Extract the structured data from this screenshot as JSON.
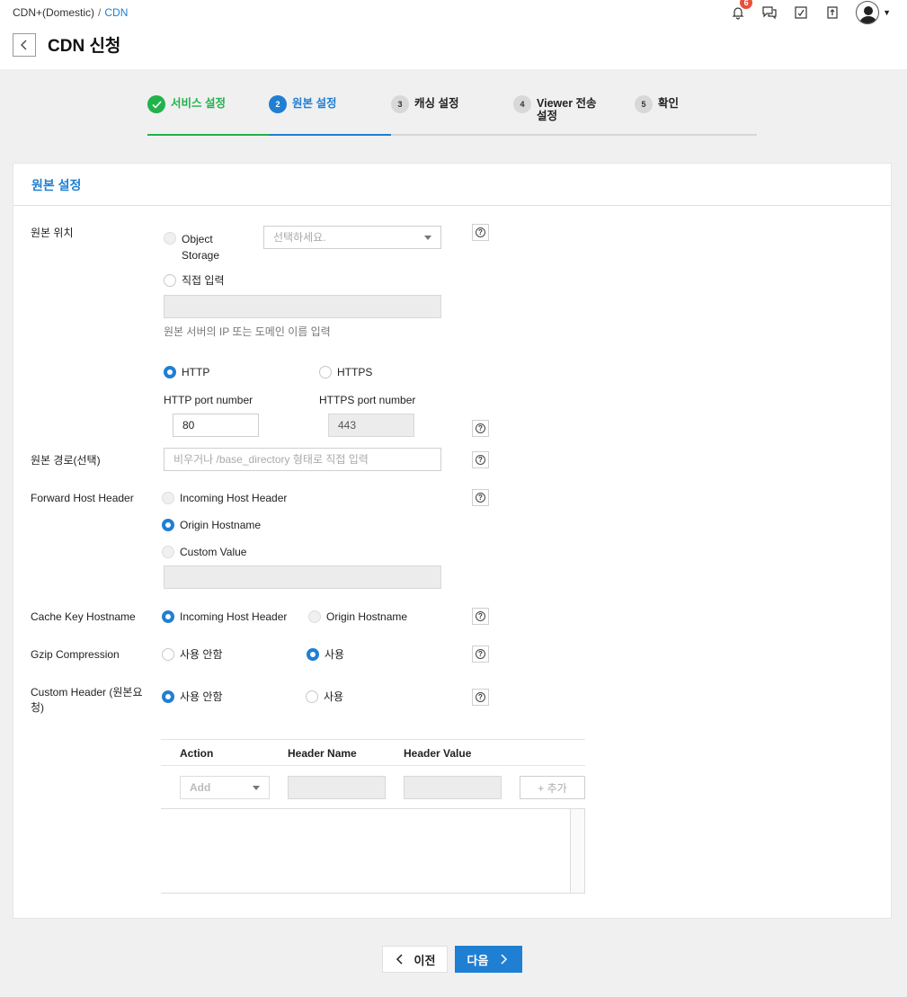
{
  "breadcrumb": {
    "parent": "CDN+(Domestic)",
    "separator": "/",
    "current": "CDN"
  },
  "header": {
    "title": "CDN 신청",
    "notification_count": "6"
  },
  "steps": [
    {
      "num": "1",
      "label": "서비스 설정",
      "state": "done"
    },
    {
      "num": "2",
      "label": "원본 설정",
      "state": "active"
    },
    {
      "num": "3",
      "label": "캐싱 설정",
      "state": "todo"
    },
    {
      "num": "4",
      "label": "Viewer 전송 설정",
      "state": "todo"
    },
    {
      "num": "5",
      "label": "확인",
      "state": "todo"
    }
  ],
  "panel": {
    "title": "원본 설정"
  },
  "origin_location": {
    "label": "원본 위치",
    "object_storage": "Object Storage",
    "select_placeholder": "선택하세요.",
    "direct_input": "직접 입력",
    "hint": "원본 서버의 IP 또는 도메인 이름 입력",
    "http": "HTTP",
    "https": "HTTPS",
    "http_port_label": "HTTP port number",
    "https_port_label": "HTTPS port number",
    "http_port": "80",
    "https_port": "443"
  },
  "origin_path": {
    "label": "원본 경로(선택)",
    "placeholder": "비우거나 /base_directory 형태로 직접 입력"
  },
  "forward_host_header": {
    "label": "Forward Host Header",
    "opt1": "Incoming Host Header",
    "opt2": "Origin Hostname",
    "opt3": "Custom Value"
  },
  "cache_key_hostname": {
    "label": "Cache Key Hostname",
    "opt1": "Incoming Host Header",
    "opt2": "Origin Hostname"
  },
  "gzip": {
    "label": "Gzip Compression",
    "off": "사용 안함",
    "on": "사용"
  },
  "custom_header": {
    "label": "Custom Header (원본요청)",
    "off": "사용 안함",
    "on": "사용",
    "col_action": "Action",
    "col_name": "Header Name",
    "col_value": "Header Value",
    "action_placeholder": "Add",
    "add_button": "+ 추가"
  },
  "nav": {
    "prev": "이전",
    "next": "다음"
  },
  "help_glyph": "?"
}
